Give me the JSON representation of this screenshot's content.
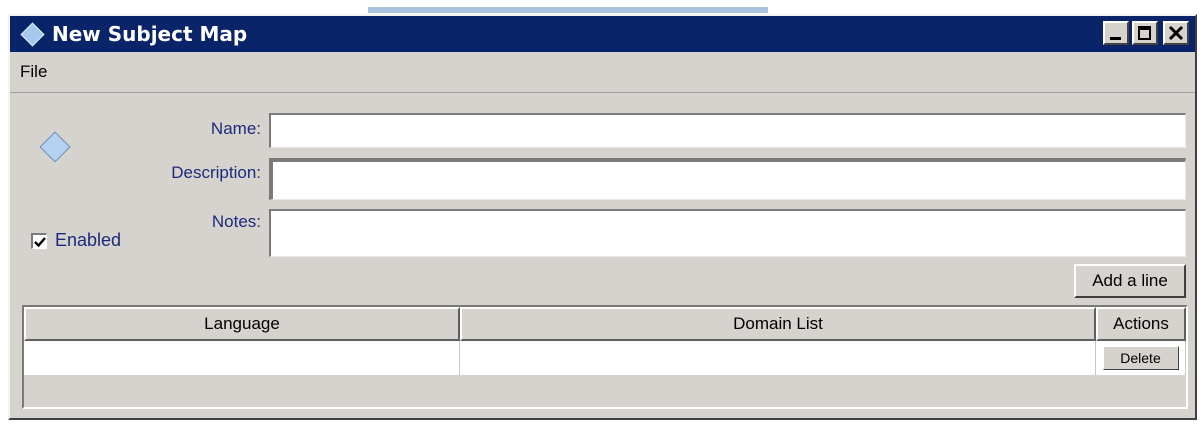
{
  "window": {
    "title": "New Subject Map",
    "controls": [
      "minimize",
      "maximize",
      "close"
    ]
  },
  "menu": {
    "items": [
      "File"
    ]
  },
  "form": {
    "name_label": "Name:",
    "name_value": "",
    "description_label": "Description:",
    "description_value": "",
    "notes_label": "Notes:",
    "notes_value": "",
    "enabled_label": "Enabled",
    "enabled_checked": true
  },
  "buttons": {
    "add_line": "Add a line",
    "delete": "Delete"
  },
  "table": {
    "columns": [
      "Language",
      "Domain List",
      "Actions"
    ],
    "rows": [
      {
        "language": "",
        "domain_list": "",
        "action": "Delete"
      }
    ]
  },
  "icons": {
    "window_icon": "diamond-icon",
    "form_icon": "diamond-icon"
  }
}
